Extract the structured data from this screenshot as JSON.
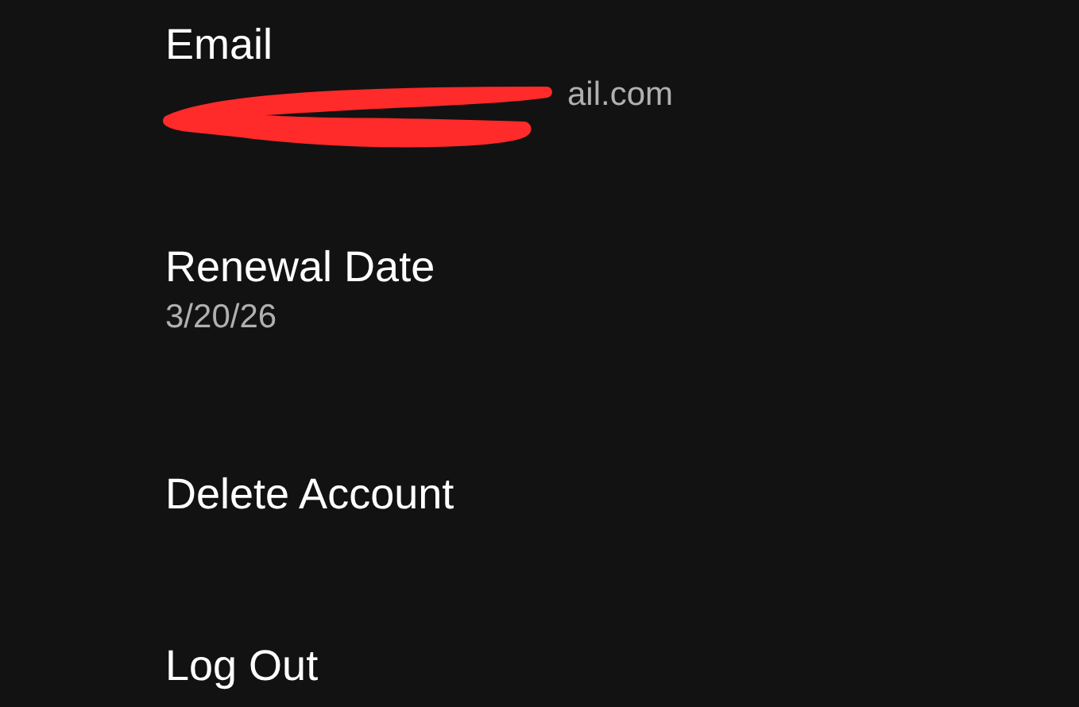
{
  "settings": [
    {
      "kind": "detail",
      "title": "Email",
      "value": "ail.com",
      "redacted": true
    },
    {
      "kind": "detail",
      "title": "Renewal Date",
      "value": "3/20/26"
    },
    {
      "kind": "action",
      "title": "Delete Account"
    },
    {
      "kind": "action",
      "title": "Log Out"
    }
  ]
}
